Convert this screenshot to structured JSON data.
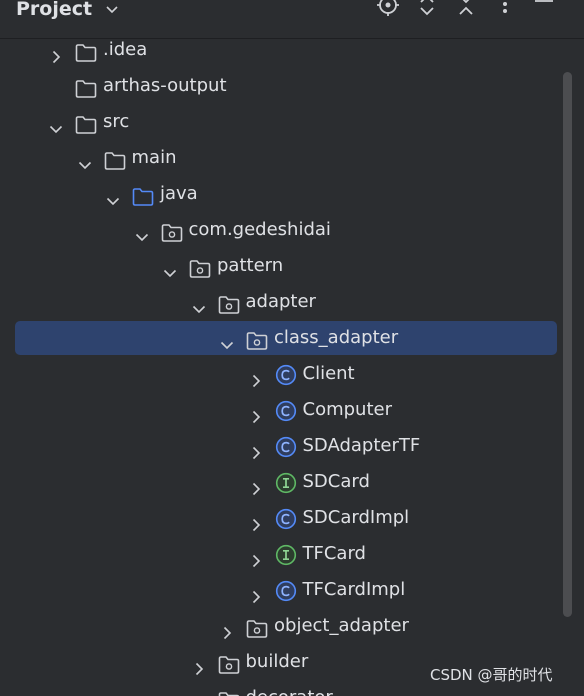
{
  "panel": {
    "title": "Project"
  },
  "tree": [
    {
      "label": ".idea",
      "arrow": "right",
      "icon": "folder"
    },
    {
      "label": "arthas-output",
      "arrow": "none",
      "icon": "folder"
    },
    {
      "label": "src",
      "arrow": "down",
      "icon": "folder"
    },
    {
      "label": "main",
      "arrow": "down",
      "icon": "folder"
    },
    {
      "label": "java",
      "arrow": "down",
      "icon": "source-folder"
    },
    {
      "label": "com.gedeshidai",
      "arrow": "down",
      "icon": "package"
    },
    {
      "label": "pattern",
      "arrow": "down",
      "icon": "package"
    },
    {
      "label": "adapter",
      "arrow": "down",
      "icon": "package"
    },
    {
      "label": "class_adapter",
      "arrow": "down",
      "icon": "package",
      "selected": true
    },
    {
      "label": "Client",
      "arrow": "right",
      "icon": "class"
    },
    {
      "label": "Computer",
      "arrow": "right",
      "icon": "class"
    },
    {
      "label": "SDAdapterTF",
      "arrow": "right",
      "icon": "class"
    },
    {
      "label": "SDCard",
      "arrow": "right",
      "icon": "interface"
    },
    {
      "label": "SDCardImpl",
      "arrow": "right",
      "icon": "class"
    },
    {
      "label": "TFCard",
      "arrow": "right",
      "icon": "interface"
    },
    {
      "label": "TFCardImpl",
      "arrow": "right",
      "icon": "class"
    },
    {
      "label": "object_adapter",
      "arrow": "right",
      "icon": "package"
    },
    {
      "label": "builder",
      "arrow": "right",
      "icon": "package"
    },
    {
      "label": "decorator",
      "arrow": "right",
      "icon": "package"
    }
  ],
  "watermark": "CSDN @哥的时代",
  "colors": {
    "background": "#2b2d30",
    "selection": "#2e436e",
    "class_icon": "#548af7",
    "interface_icon": "#5fb865",
    "text": "#dfe1e5"
  }
}
